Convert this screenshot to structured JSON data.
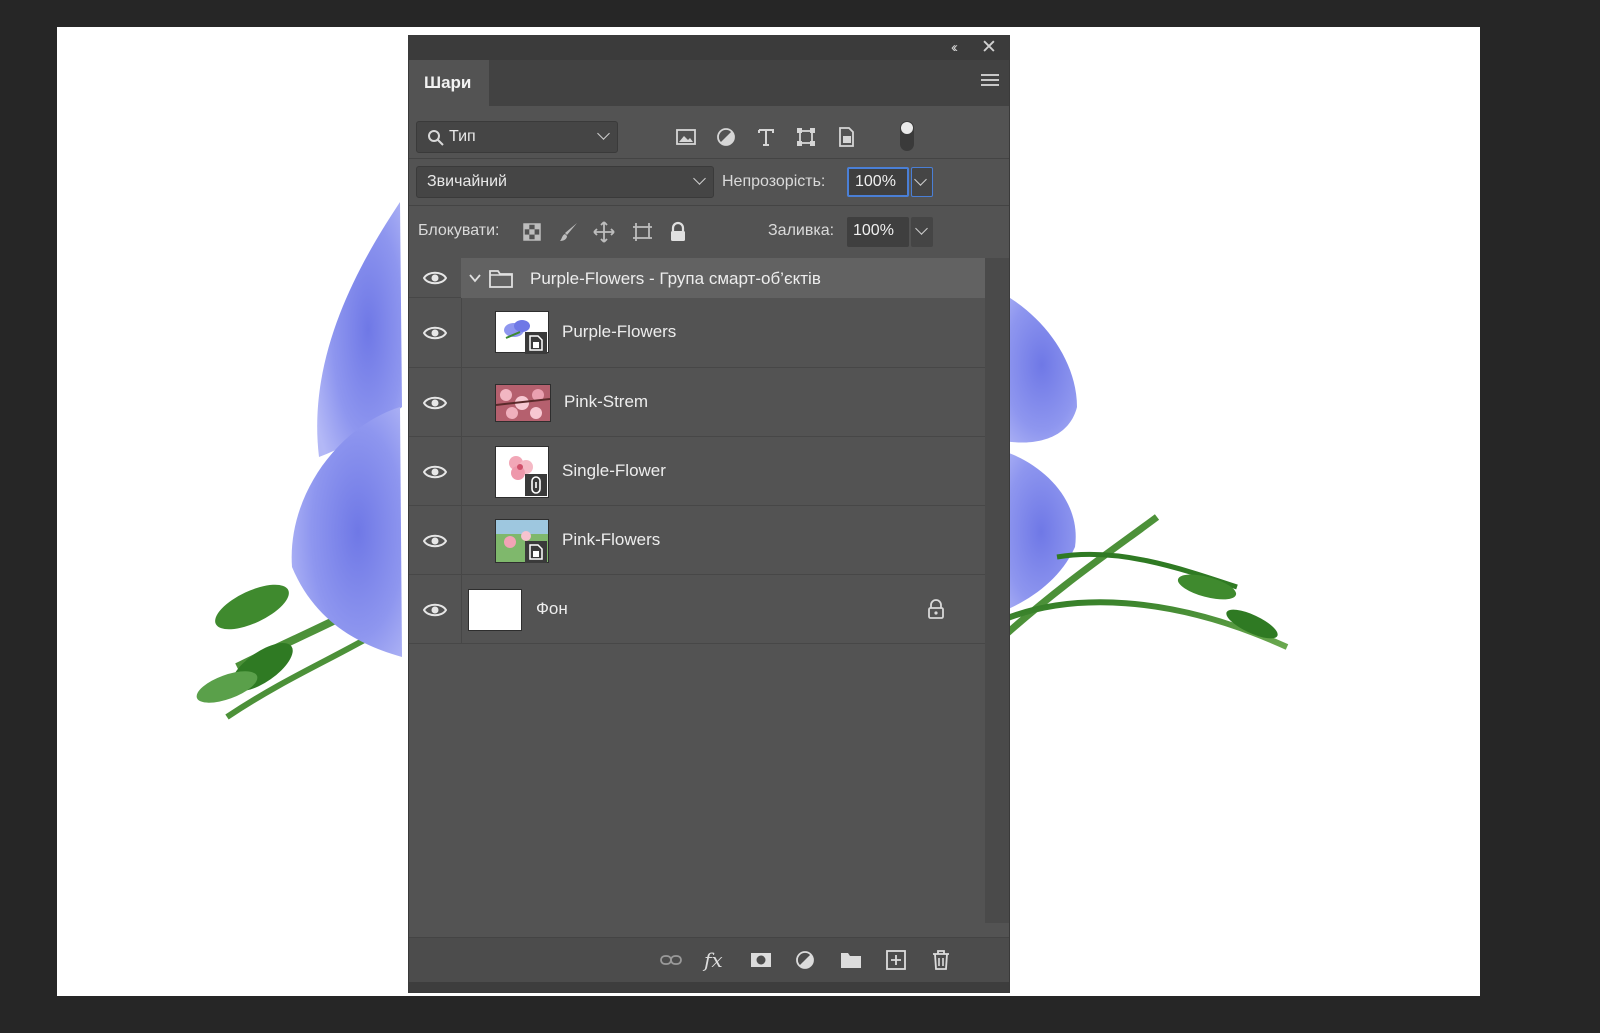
{
  "panel": {
    "tab_label": "Шари",
    "collapse_glyph": "‹‹",
    "close_glyph": "✕"
  },
  "filter": {
    "kind_label": "Тип",
    "icons": [
      "image-filter-icon",
      "adjustment-filter-icon",
      "type-filter-icon",
      "shape-filter-icon",
      "smart-object-filter-icon",
      "filter-toggle-icon"
    ]
  },
  "blend": {
    "mode": "Звичайний",
    "opacity_label": "Непрозорість:",
    "opacity_value": "100%"
  },
  "lock": {
    "label": "Блокувати:",
    "icons": [
      "lock-transparent-icon",
      "lock-image-icon",
      "lock-position-icon",
      "lock-artboard-icon",
      "lock-all-icon"
    ],
    "fill_label": "Заливка:",
    "fill_value": "100%"
  },
  "layers": [
    {
      "name": "Purple-Flowers - Група смарт-об’єктів",
      "type": "group"
    },
    {
      "name": "Purple-Flowers",
      "type": "smart-object"
    },
    {
      "name": "Pink-Strem",
      "type": "pixel"
    },
    {
      "name": "Single-Flower",
      "type": "smart-object-linked"
    },
    {
      "name": "Pink-Flowers",
      "type": "smart-object"
    },
    {
      "name": "Фон",
      "type": "background",
      "locked": true
    }
  ],
  "colors": {
    "panel_bg": "#535353",
    "selected_row": "#626262",
    "accent_focus": "#4a7fd6",
    "petal": "#8e96ef",
    "stem": "#3d8a2f"
  },
  "bottom_bar": {
    "icons": [
      "link-layers-icon",
      "fx-icon",
      "add-mask-icon",
      "new-adjustment-icon",
      "new-group-icon",
      "new-layer-icon",
      "trash-icon"
    ],
    "fx_text": "fx"
  }
}
